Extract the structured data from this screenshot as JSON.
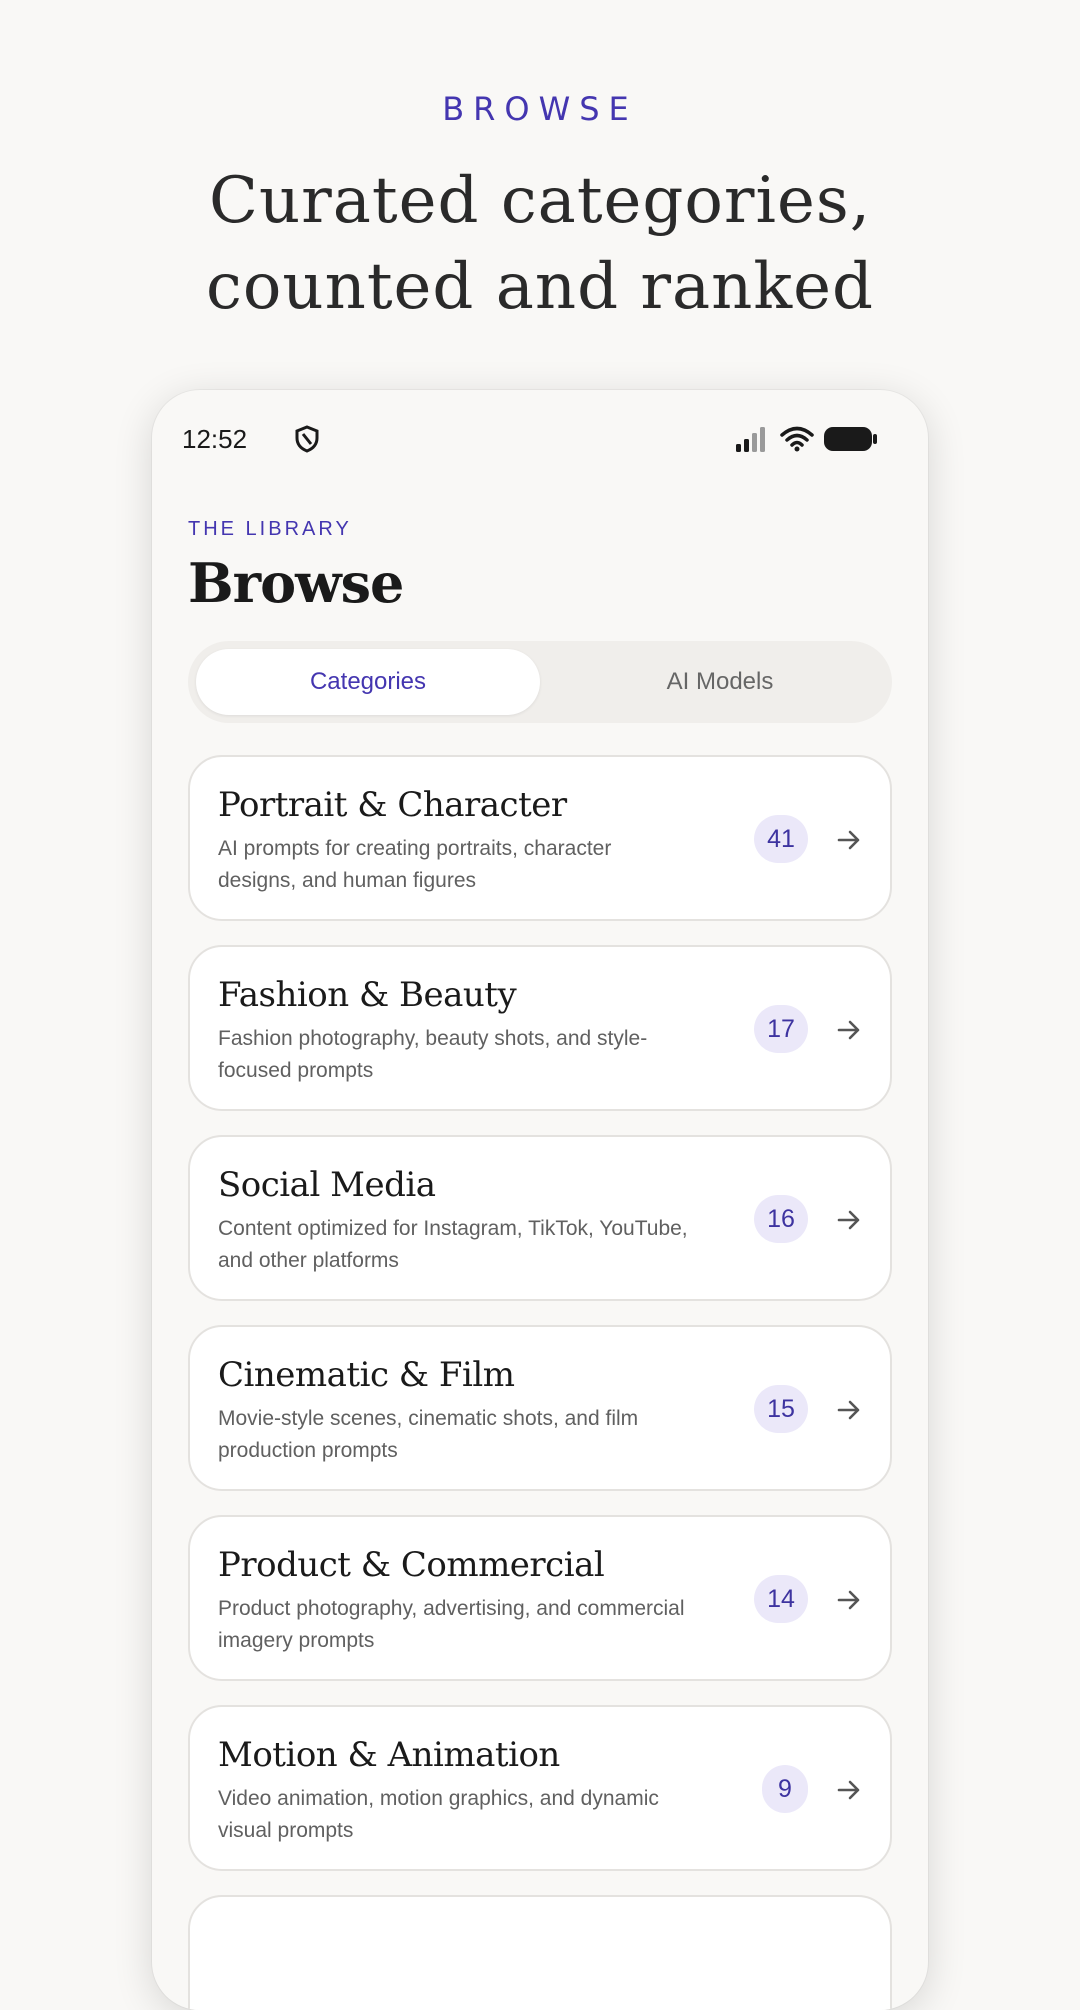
{
  "hero": {
    "eyebrow": "BROWSE",
    "headline_line1": "Curated categories,",
    "headline_line2": "counted and ranked"
  },
  "status_bar": {
    "time": "12:52",
    "icons": [
      "shield-icon",
      "signal-icon",
      "wifi-icon",
      "battery-icon"
    ]
  },
  "header": {
    "section_label": "THE LIBRARY",
    "title": "Browse"
  },
  "tabs": [
    {
      "label": "Categories",
      "active": true
    },
    {
      "label": "AI Models",
      "active": false
    }
  ],
  "categories": [
    {
      "title": "Portrait & Character",
      "description": "AI prompts for creating portraits, character designs, and human figures",
      "count": "41"
    },
    {
      "title": "Fashion & Beauty",
      "description": "Fashion photography, beauty shots, and style-focused prompts",
      "count": "17"
    },
    {
      "title": "Social Media",
      "description": "Content optimized for Instagram, TikTok, YouTube, and other platforms",
      "count": "16"
    },
    {
      "title": "Cinematic & Film",
      "description": "Movie-style scenes, cinematic shots, and film production prompts",
      "count": "15"
    },
    {
      "title": "Product & Commercial",
      "description": "Product photography, advertising, and commercial imagery prompts",
      "count": "14"
    },
    {
      "title": "Motion & Animation",
      "description": "Video animation, motion graphics, and dynamic visual prompts",
      "count": "9"
    }
  ],
  "colors": {
    "accent": "#4436b0",
    "badge_bg": "#ebe8f9",
    "background": "#f9f8f6"
  }
}
